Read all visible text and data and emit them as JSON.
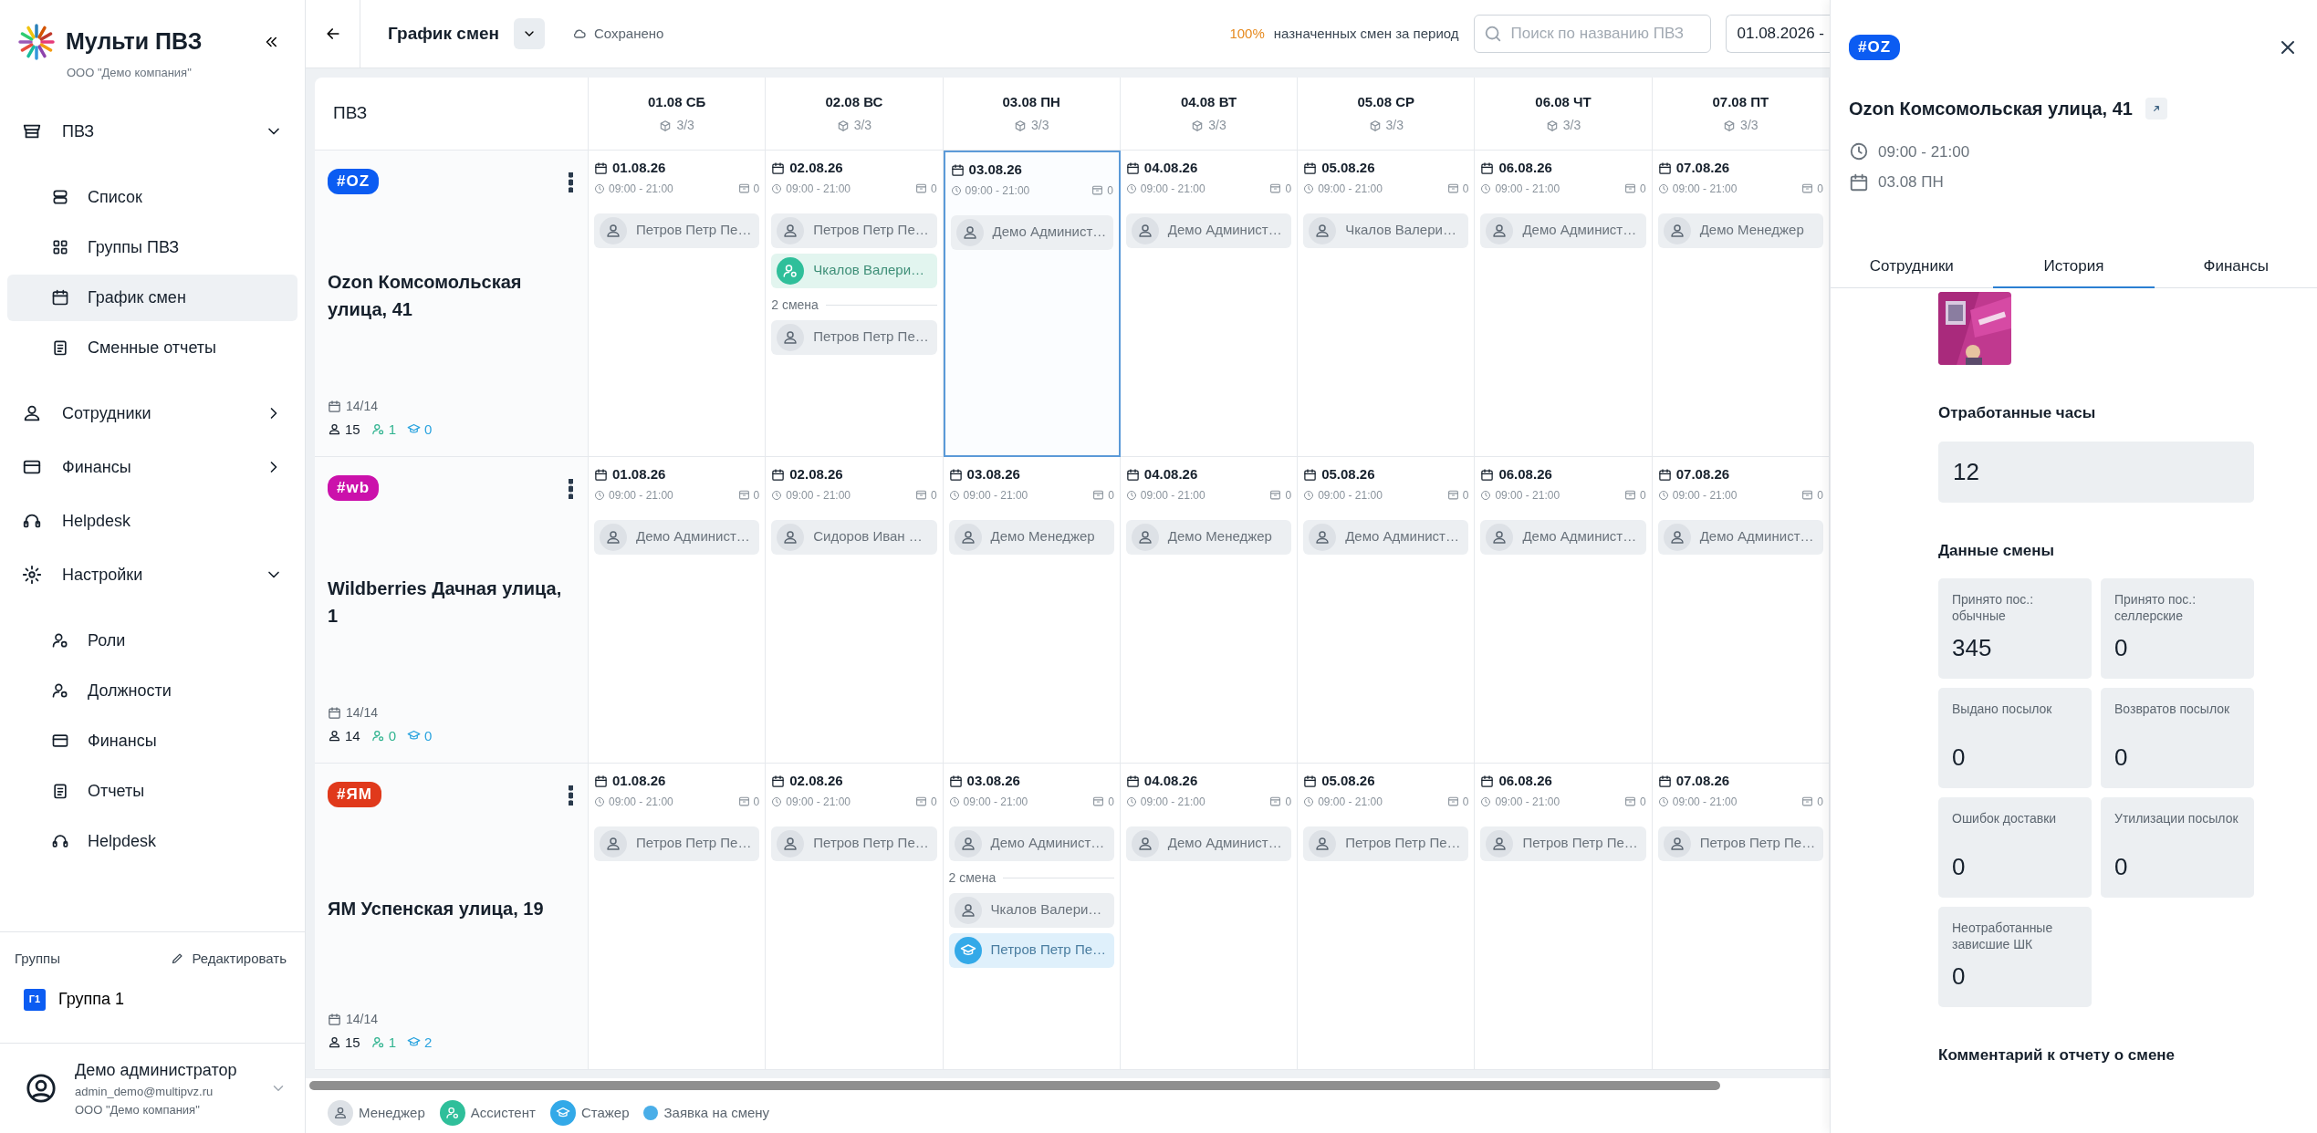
{
  "sidebar": {
    "logo": "Мульти ПВЗ",
    "company": "ООО \"Демо компания\"",
    "nav": [
      {
        "kind": "group",
        "label": "ПВЗ",
        "expanded": true,
        "children": [
          {
            "label": "Список",
            "selected": false
          },
          {
            "label": "Группы ПВЗ",
            "selected": false
          },
          {
            "label": "График смен",
            "selected": true
          },
          {
            "label": "Сменные отчеты",
            "selected": false
          }
        ]
      },
      {
        "kind": "group",
        "label": "Сотрудники",
        "expanded": false
      },
      {
        "kind": "group",
        "label": "Финансы",
        "expanded": false
      },
      {
        "kind": "link",
        "label": "Helpdesk",
        "selected": false
      },
      {
        "kind": "group",
        "label": "Настройки",
        "expanded": true,
        "children": [
          {
            "label": "Роли",
            "selected": false
          },
          {
            "label": "Должности",
            "selected": false
          },
          {
            "label": "Финансы",
            "selected": false
          },
          {
            "label": "Отчеты",
            "selected": false
          },
          {
            "label": "Helpdesk",
            "selected": false
          }
        ]
      }
    ],
    "groups_title": "Группы",
    "groups_edit": "Редактировать",
    "groups": [
      {
        "initials": "Г1",
        "label": "Группа 1"
      }
    ],
    "user": {
      "name": "Демо администратор",
      "email": "admin_demo@multipvz.ru",
      "company": "ООО \"Демо компания\""
    }
  },
  "header": {
    "title": "График смен",
    "saved": "Сохранено",
    "percent": "100%",
    "percent_label": "назначенных смен за период",
    "search_placeholder": "Поиск по названию ПВЗ",
    "date_range": "01.08.2026 -"
  },
  "grid": {
    "corner": "ПВЗ",
    "days": [
      {
        "label": "01.08 СБ",
        "count": "3/3"
      },
      {
        "label": "02.08 ВС",
        "count": "3/3"
      },
      {
        "label": "03.08 ПН",
        "count": "3/3"
      },
      {
        "label": "04.08 ВТ",
        "count": "3/3"
      },
      {
        "label": "05.08 СР",
        "count": "3/3"
      },
      {
        "label": "06.08 ЧТ",
        "count": "3/3"
      },
      {
        "label": "07.08 ПТ",
        "count": "3/3"
      }
    ],
    "rows": [
      {
        "tag": {
          "text": "#OZ",
          "color": "#0b5cf2"
        },
        "name": "Ozon Комсомольская улица, 41",
        "shifts": "14/14",
        "staff": "15",
        "assistants": "1",
        "trainees": "0",
        "cells": [
          {
            "date": "01.08.26",
            "time": "09:00 - 21:00",
            "count": "0",
            "selected": false,
            "entries": [
              {
                "kind": "manager",
                "name": "Петров Петр Пе…"
              }
            ]
          },
          {
            "date": "02.08.26",
            "time": "09:00 - 21:00",
            "count": "0",
            "selected": false,
            "entries": [
              {
                "kind": "manager",
                "name": "Петров Петр Пе…"
              },
              {
                "kind": "assistant",
                "name": "Чкалов Валери…"
              },
              {
                "kind": "divider",
                "label": "2 смена"
              },
              {
                "kind": "manager",
                "name": "Петров Петр Пе…"
              }
            ]
          },
          {
            "date": "03.08.26",
            "time": "09:00 - 21:00",
            "count": "0",
            "selected": true,
            "entries": [
              {
                "kind": "manager",
                "name": "Демо Админист…"
              }
            ]
          },
          {
            "date": "04.08.26",
            "time": "09:00 - 21:00",
            "count": "0",
            "selected": false,
            "entries": [
              {
                "kind": "manager",
                "name": "Демо Админист…"
              }
            ]
          },
          {
            "date": "05.08.26",
            "time": "09:00 - 21:00",
            "count": "0",
            "selected": false,
            "entries": [
              {
                "kind": "manager",
                "name": "Чкалов Валери…"
              }
            ]
          },
          {
            "date": "06.08.26",
            "time": "09:00 - 21:00",
            "count": "0",
            "selected": false,
            "entries": [
              {
                "kind": "manager",
                "name": "Демо Админист…"
              }
            ]
          },
          {
            "date": "07.08.26",
            "time": "09:00 - 21:00",
            "count": "0",
            "selected": false,
            "entries": [
              {
                "kind": "manager",
                "name": "Демо Менеджер"
              }
            ]
          }
        ]
      },
      {
        "tag": {
          "text": "#wb",
          "color": "#cb11ab"
        },
        "name": "Wildberries Дачная улица, 1",
        "shifts": "14/14",
        "staff": "14",
        "assistants": "0",
        "trainees": "0",
        "cells": [
          {
            "date": "01.08.26",
            "time": "09:00 - 21:00",
            "count": "0",
            "selected": false,
            "entries": [
              {
                "kind": "manager",
                "name": "Демо Админист…"
              }
            ]
          },
          {
            "date": "02.08.26",
            "time": "09:00 - 21:00",
            "count": "0",
            "selected": false,
            "entries": [
              {
                "kind": "manager",
                "name": "Сидоров Иван …"
              }
            ]
          },
          {
            "date": "03.08.26",
            "time": "09:00 - 21:00",
            "count": "0",
            "selected": false,
            "entries": [
              {
                "kind": "manager",
                "name": "Демо Менеджер"
              }
            ]
          },
          {
            "date": "04.08.26",
            "time": "09:00 - 21:00",
            "count": "0",
            "selected": false,
            "entries": [
              {
                "kind": "manager",
                "name": "Демо Менеджер"
              }
            ]
          },
          {
            "date": "05.08.26",
            "time": "09:00 - 21:00",
            "count": "0",
            "selected": false,
            "entries": [
              {
                "kind": "manager",
                "name": "Демо Админист…"
              }
            ]
          },
          {
            "date": "06.08.26",
            "time": "09:00 - 21:00",
            "count": "0",
            "selected": false,
            "entries": [
              {
                "kind": "manager",
                "name": "Демо Админист…"
              }
            ]
          },
          {
            "date": "07.08.26",
            "time": "09:00 - 21:00",
            "count": "0",
            "selected": false,
            "entries": [
              {
                "kind": "manager",
                "name": "Демо Админист…"
              }
            ]
          }
        ]
      },
      {
        "tag": {
          "text": "#ЯМ",
          "color": "#e0391b"
        },
        "name": "ЯМ Успенская улица, 19",
        "shifts": "14/14",
        "staff": "15",
        "assistants": "1",
        "trainees": "2",
        "cells": [
          {
            "date": "01.08.26",
            "time": "09:00 - 21:00",
            "count": "0",
            "selected": false,
            "entries": [
              {
                "kind": "manager",
                "name": "Петров Петр Пе…"
              }
            ]
          },
          {
            "date": "02.08.26",
            "time": "09:00 - 21:00",
            "count": "0",
            "selected": false,
            "entries": [
              {
                "kind": "manager",
                "name": "Петров Петр Пе…"
              }
            ]
          },
          {
            "date": "03.08.26",
            "time": "09:00 - 21:00",
            "count": "0",
            "selected": false,
            "entries": [
              {
                "kind": "manager",
                "name": "Демо Админист…"
              },
              {
                "kind": "divider",
                "label": "2 смена"
              },
              {
                "kind": "manager",
                "name": "Чкалов Валери…"
              },
              {
                "kind": "trainee",
                "name": "Петров Петр Пе…"
              }
            ]
          },
          {
            "date": "04.08.26",
            "time": "09:00 - 21:00",
            "count": "0",
            "selected": false,
            "entries": [
              {
                "kind": "manager",
                "name": "Демо Админист…"
              }
            ]
          },
          {
            "date": "05.08.26",
            "time": "09:00 - 21:00",
            "count": "0",
            "selected": false,
            "entries": [
              {
                "kind": "manager",
                "name": "Петров Петр Пе…"
              }
            ]
          },
          {
            "date": "06.08.26",
            "time": "09:00 - 21:00",
            "count": "0",
            "selected": false,
            "entries": [
              {
                "kind": "manager",
                "name": "Петров Петр Пе…"
              }
            ]
          },
          {
            "date": "07.08.26",
            "time": "09:00 - 21:00",
            "count": "0",
            "selected": false,
            "entries": [
              {
                "kind": "manager",
                "name": "Петров Петр Пе…"
              }
            ]
          }
        ]
      }
    ]
  },
  "legend": [
    {
      "kind": "manager",
      "label": "Менеджер"
    },
    {
      "kind": "assistant",
      "label": "Ассистент"
    },
    {
      "kind": "trainee",
      "label": "Стажер"
    },
    {
      "kind": "request",
      "label": "Заявка на смену"
    }
  ],
  "panel": {
    "tag": {
      "text": "#OZ",
      "color": "#0b5cf2"
    },
    "title": "Ozon Комсомольская улица, 41",
    "time": "09:00 - 21:00",
    "date": "03.08 ПН",
    "tabs": [
      {
        "label": "Сотрудники",
        "selected": false
      },
      {
        "label": "История",
        "selected": true
      },
      {
        "label": "Финансы",
        "selected": false
      }
    ],
    "hours_title": "Отработанные часы",
    "hours": "12",
    "data_title": "Данные смены",
    "stats": [
      {
        "label": "Принято пос.: обычные",
        "value": "345"
      },
      {
        "label": "Принято пос.: селлерские",
        "value": "0"
      },
      {
        "label": "Выдано посылок",
        "value": "0"
      },
      {
        "label": "Возвратов посылок",
        "value": "0"
      },
      {
        "label": "Ошибок доставки",
        "value": "0"
      },
      {
        "label": "Утилизации посылок",
        "value": "0"
      },
      {
        "label": "Неотработанные зависшие ШК",
        "value": "0"
      }
    ],
    "comment_title": "Комментарий к отчету о смене"
  }
}
